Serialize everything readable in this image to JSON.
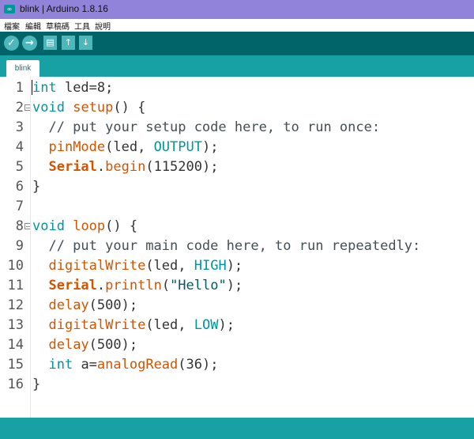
{
  "window": {
    "title": "blink | Arduino 1.8.16",
    "app_icon": "∞"
  },
  "menu": {
    "items": [
      "檔案",
      "編輯",
      "草稿碼",
      "工具",
      "說明"
    ]
  },
  "toolbar": {
    "verify": "✓",
    "upload": "→",
    "new": "🗎",
    "open": "↑",
    "save": "↓"
  },
  "tabs": [
    {
      "label": "blink"
    }
  ],
  "colors": {
    "toolbar": "#006468",
    "tabbar": "#17a1a5",
    "keyword": "#00979c",
    "function": "#d35400"
  },
  "editor": {
    "line_numbers": [
      "1",
      "2",
      "3",
      "4",
      "5",
      "6",
      "7",
      "8",
      "9",
      "10",
      "11",
      "12",
      "13",
      "14",
      "15",
      "16"
    ],
    "fold_markers": {
      "2": "⊟",
      "8": "⊟"
    },
    "lines": [
      [
        {
          "t": "int",
          "c": "kw"
        },
        {
          "t": " led=8;",
          "c": ""
        }
      ],
      [
        {
          "t": "void",
          "c": "kw"
        },
        {
          "t": " ",
          "c": ""
        },
        {
          "t": "setup",
          "c": "fn"
        },
        {
          "t": "() {",
          "c": ""
        }
      ],
      [
        {
          "t": "  // put your setup code here, to run once:",
          "c": "cmt"
        }
      ],
      [
        {
          "t": "  ",
          "c": ""
        },
        {
          "t": "pinMode",
          "c": "fn"
        },
        {
          "t": "(led, ",
          "c": ""
        },
        {
          "t": "OUTPUT",
          "c": "const"
        },
        {
          "t": ");",
          "c": ""
        }
      ],
      [
        {
          "t": "  ",
          "c": ""
        },
        {
          "t": "Serial",
          "c": "cls"
        },
        {
          "t": ".",
          "c": ""
        },
        {
          "t": "begin",
          "c": "fn"
        },
        {
          "t": "(115200);",
          "c": ""
        }
      ],
      [
        {
          "t": "}",
          "c": ""
        }
      ],
      [
        {
          "t": "",
          "c": ""
        }
      ],
      [
        {
          "t": "void",
          "c": "kw"
        },
        {
          "t": " ",
          "c": ""
        },
        {
          "t": "loop",
          "c": "fn"
        },
        {
          "t": "() {",
          "c": ""
        }
      ],
      [
        {
          "t": "  // put your main code here, to run repeatedly:",
          "c": "cmt"
        }
      ],
      [
        {
          "t": "  ",
          "c": ""
        },
        {
          "t": "digitalWrite",
          "c": "fn"
        },
        {
          "t": "(led, ",
          "c": ""
        },
        {
          "t": "HIGH",
          "c": "const"
        },
        {
          "t": ");",
          "c": ""
        }
      ],
      [
        {
          "t": "  ",
          "c": ""
        },
        {
          "t": "Serial",
          "c": "cls"
        },
        {
          "t": ".",
          "c": ""
        },
        {
          "t": "println",
          "c": "fn"
        },
        {
          "t": "(",
          "c": ""
        },
        {
          "t": "\"Hello\"",
          "c": "str"
        },
        {
          "t": ");",
          "c": ""
        }
      ],
      [
        {
          "t": "  ",
          "c": ""
        },
        {
          "t": "delay",
          "c": "fn"
        },
        {
          "t": "(500);",
          "c": ""
        }
      ],
      [
        {
          "t": "  ",
          "c": ""
        },
        {
          "t": "digitalWrite",
          "c": "fn"
        },
        {
          "t": "(led, ",
          "c": ""
        },
        {
          "t": "LOW",
          "c": "const"
        },
        {
          "t": ");",
          "c": ""
        }
      ],
      [
        {
          "t": "  ",
          "c": ""
        },
        {
          "t": "delay",
          "c": "fn"
        },
        {
          "t": "(500);",
          "c": ""
        }
      ],
      [
        {
          "t": "  ",
          "c": ""
        },
        {
          "t": "int",
          "c": "kw"
        },
        {
          "t": " a=",
          "c": ""
        },
        {
          "t": "analogRead",
          "c": "fn"
        },
        {
          "t": "(36);",
          "c": ""
        }
      ],
      [
        {
          "t": "}",
          "c": ""
        }
      ]
    ]
  }
}
